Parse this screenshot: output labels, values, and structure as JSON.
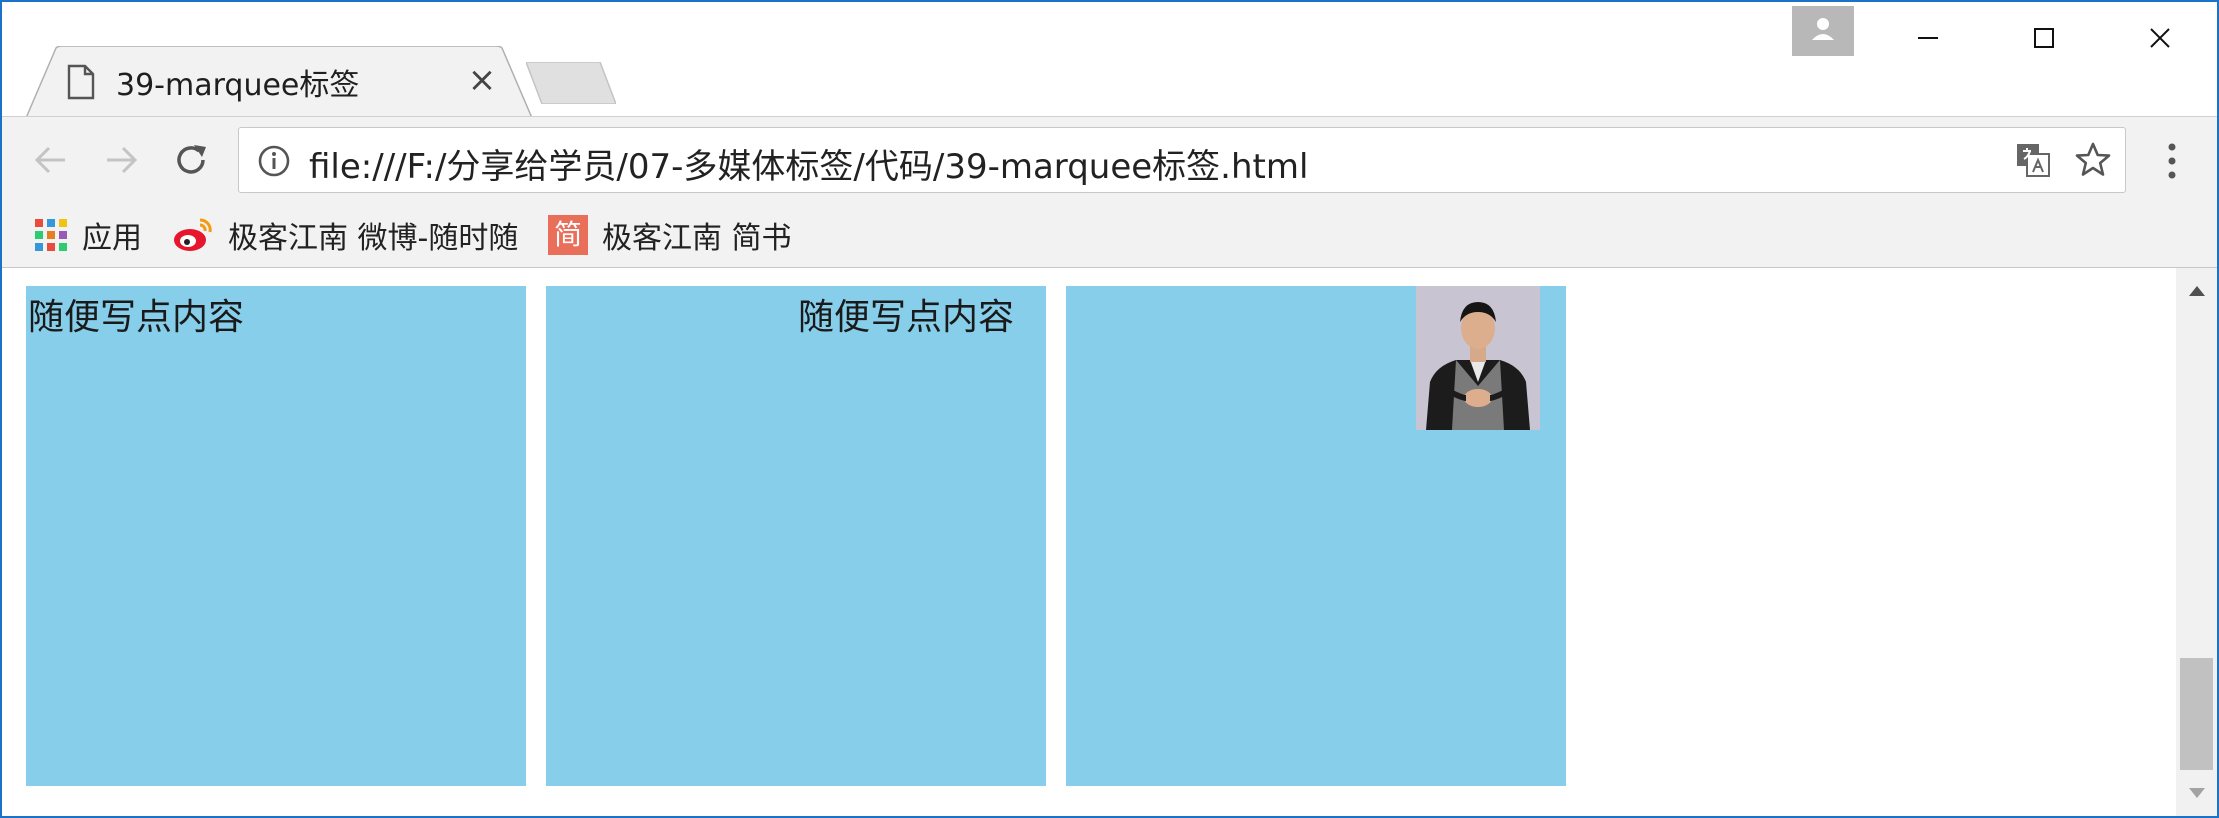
{
  "tab": {
    "title": "39-marquee标签",
    "close_glyph": "×"
  },
  "omnibox": {
    "url": "file:///F:/分享给学员/07-多媒体标签/代码/39-marquee标签.html"
  },
  "bookmarks": [
    {
      "label": "应用",
      "icon": "apps-grid-icon"
    },
    {
      "label": "极客江南 微博-随时随",
      "icon": "weibo-icon"
    },
    {
      "label": "极客江南 简书",
      "icon": "jianshu-icon",
      "badge": "简"
    }
  ],
  "content": {
    "box1_text": "随便写点内容",
    "box2_text": "随便写点内容",
    "box_color": "#87ceeb"
  },
  "colors": {
    "window_border": "#1a73c9",
    "toolbar_bg": "#f2f2f2",
    "jianshu": "#ea6f5a"
  }
}
